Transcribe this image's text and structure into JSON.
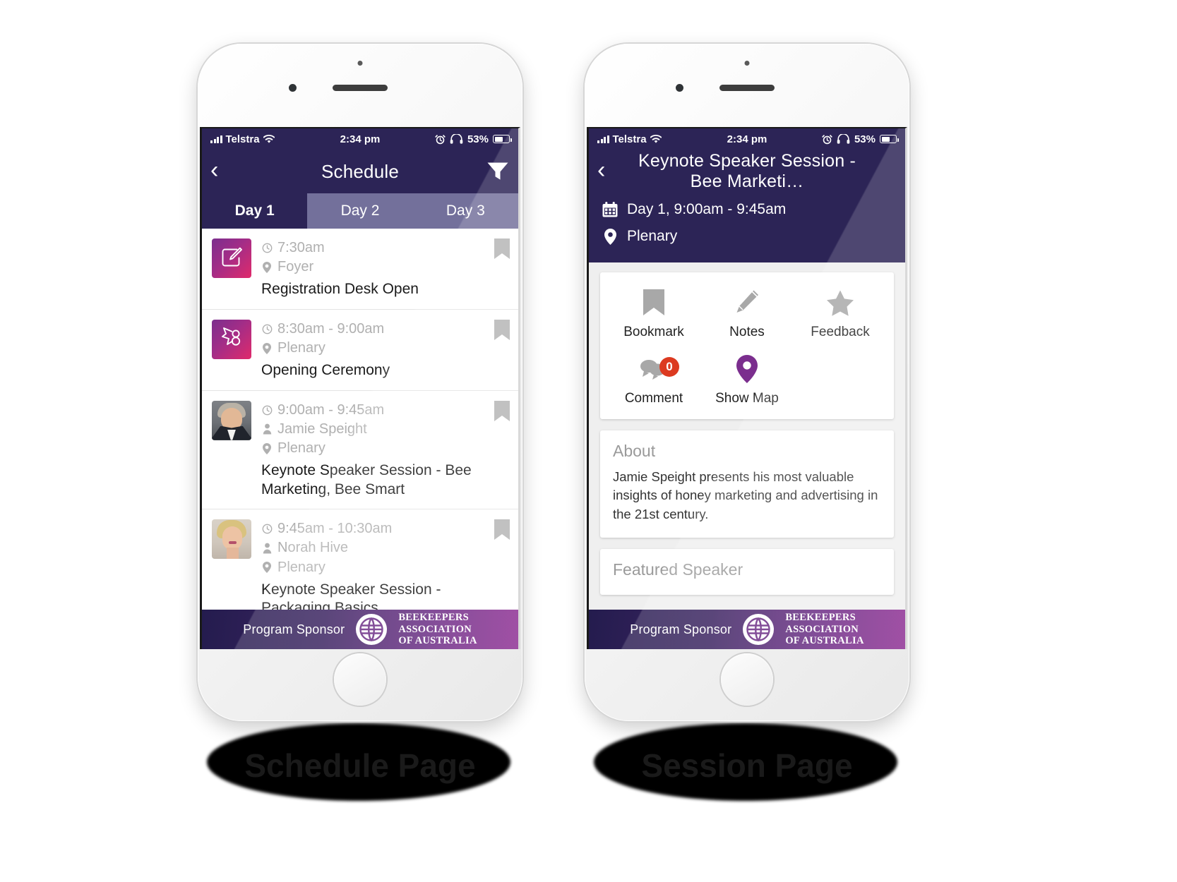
{
  "statusbar": {
    "carrier": "Telstra",
    "time": "2:34 pm",
    "battery_percent": "53%",
    "icons": [
      "signal-bars-icon",
      "wifi-icon",
      "alarm-clock-icon",
      "headphones-icon",
      "battery-icon"
    ]
  },
  "schedule_phone": {
    "caption": "Schedule Page",
    "nav": {
      "back_label": "‹",
      "title": "Schedule",
      "filter_icon": "filter-funnel-icon"
    },
    "tabs": [
      {
        "label": "Day 1",
        "active": true
      },
      {
        "label": "Day 2",
        "active": false
      },
      {
        "label": "Day 3",
        "active": false
      }
    ],
    "sessions": [
      {
        "time": "7:30am",
        "speaker": "",
        "location": "Foyer",
        "title": "Registration Desk Open",
        "thumb": "registration-pencil-icon",
        "bookmark_icon": "bookmark-icon"
      },
      {
        "time": "8:30am - 9:00am",
        "speaker": "",
        "location": "Plenary",
        "title": "Opening Ceremony",
        "thumb": "ceremony-ribbon-icon",
        "bookmark_icon": "bookmark-icon"
      },
      {
        "time": "9:00am - 9:45am",
        "speaker": "Jamie Speight",
        "location": "Plenary",
        "title": "Keynote Speaker Session - Bee Marketing, Bee Smart",
        "thumb": "speaker-photo-male",
        "bookmark_icon": "bookmark-icon"
      },
      {
        "time": "9:45am - 10:30am",
        "speaker": "Norah Hive",
        "location": "Plenary",
        "title": "Keynote Speaker Session - Packaging Basics",
        "thumb": "speaker-photo-female",
        "bookmark_icon": "bookmark-icon"
      }
    ]
  },
  "session_phone": {
    "caption": "Session Page",
    "nav": {
      "back_label": "‹",
      "title": "Keynote Speaker Session - Bee Marketi…"
    },
    "meta": {
      "datetime": "Day 1, 9:00am - 9:45am",
      "datetime_icon": "calendar-icon",
      "location": "Plenary",
      "location_icon": "map-pin-icon"
    },
    "actions": [
      {
        "label": "Bookmark",
        "icon": "bookmark-icon",
        "badge": ""
      },
      {
        "label": "Notes",
        "icon": "pencil-icon",
        "badge": ""
      },
      {
        "label": "Feedback",
        "icon": "star-icon",
        "badge": ""
      },
      {
        "label": "Comment",
        "icon": "comment-icon",
        "badge": "0"
      },
      {
        "label": "Show Map",
        "icon": "map-pin-icon",
        "badge": ""
      }
    ],
    "about": {
      "heading": "About",
      "text": "Jamie Speight presents his most valuable insights of honey marketing and advertising in the 21st century."
    },
    "featured_speaker": {
      "heading": "Featured Speaker"
    }
  },
  "sponsor": {
    "label": "Program Sponsor",
    "name_line1": "BEEKEEPERS",
    "name_line2": "ASSOCIATION",
    "name_line3": "OF AUSTRALIA",
    "logo_icon": "beekeepers-globe-logo"
  },
  "colors": {
    "header_navy": "#2C2456",
    "tab_inactive": "#73709B",
    "accent_purple": "#7B2E8E",
    "badge_red": "#DC3A20",
    "icon_gray": "#A8A8A8",
    "sponsor_gradient_start": "#241C4E",
    "sponsor_gradient_end": "#8E2E93"
  }
}
